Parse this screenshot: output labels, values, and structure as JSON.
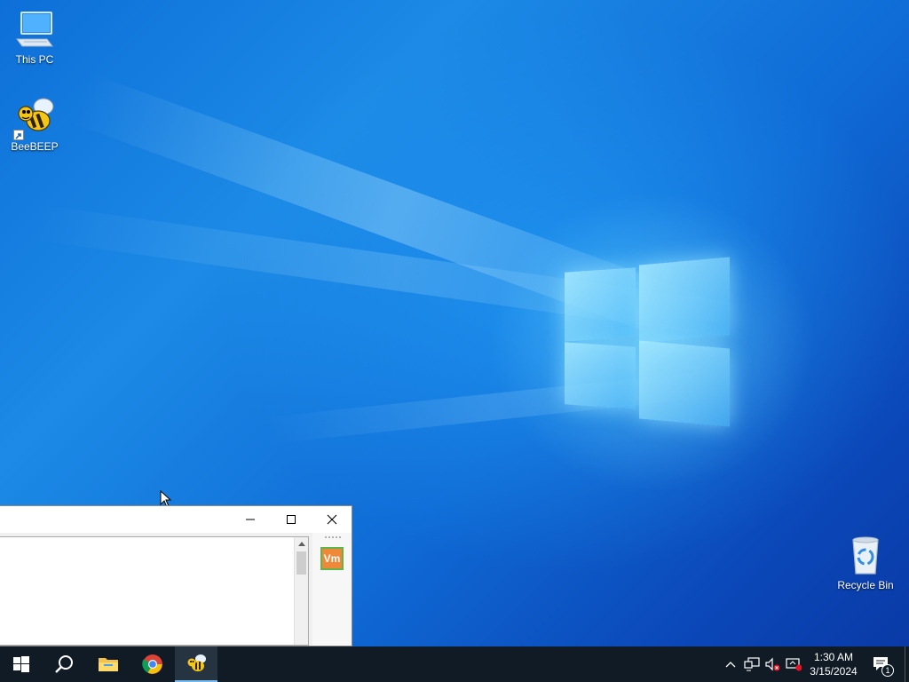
{
  "desktop": {
    "icons": [
      {
        "label": "This PC",
        "icon": "computer-icon"
      },
      {
        "label": "BeeBEEP",
        "icon": "bee-icon"
      },
      {
        "label": "Recycle Bin",
        "icon": "recycle-bin-icon"
      }
    ]
  },
  "window": {
    "controls": [
      "minimize",
      "maximize",
      "close"
    ],
    "side_badge": "Vm"
  },
  "taskbar": {
    "apps": [
      {
        "name": "start",
        "icon": "windows-start-icon"
      },
      {
        "name": "search",
        "icon": "search-icon"
      },
      {
        "name": "file-explorer",
        "icon": "folder-icon"
      },
      {
        "name": "chrome",
        "icon": "chrome-icon"
      },
      {
        "name": "beebeep",
        "icon": "bee-icon",
        "active": true
      }
    ],
    "notification_count": "1",
    "clock": {
      "time": "1:30 AM",
      "date": "3/15/2024"
    }
  },
  "colors": {
    "taskbar": "#101b26",
    "accent": "#76b9ed",
    "vm_badge_bg": "#f0883a",
    "vm_badge_border": "#62b34a"
  }
}
